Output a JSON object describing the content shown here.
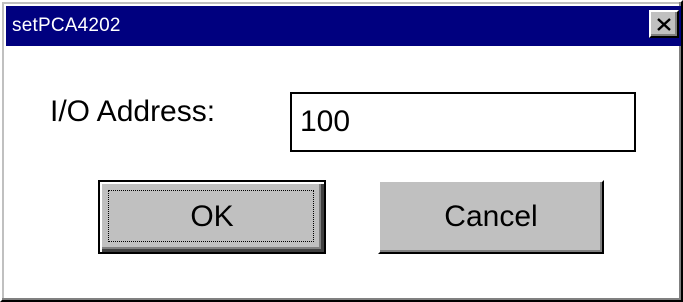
{
  "window": {
    "title": "setPCA4202",
    "close_icon": "close-x-icon"
  },
  "form": {
    "address_label": "I/O Address:",
    "address_value": "100"
  },
  "buttons": {
    "ok_label": "OK",
    "cancel_label": "Cancel"
  },
  "colors": {
    "titlebar": "#00007f",
    "title_text": "#ffffff",
    "button_face": "#c0c0c0",
    "client_bg": "#ffffff"
  }
}
